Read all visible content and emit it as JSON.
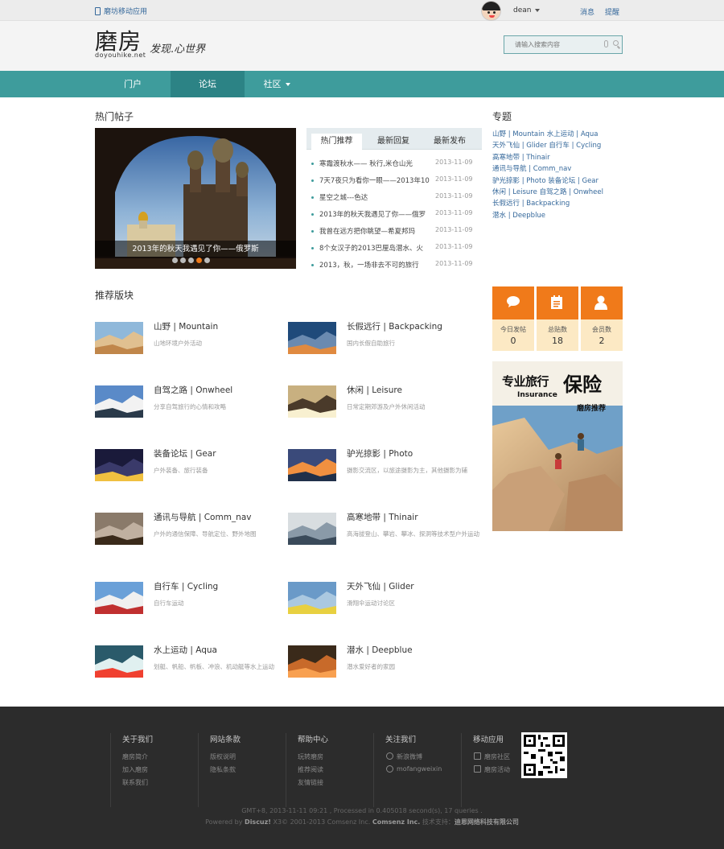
{
  "topbar": {
    "mobile_app": "磨坊移动应用",
    "username": "dean",
    "messages": "消息",
    "reminders": "提醒"
  },
  "header": {
    "logo": "磨房",
    "logo_sub": "doyouhike.net",
    "slogan": "发现.心世界",
    "search_placeholder": "请输入搜索内容"
  },
  "nav": {
    "items": [
      "门户",
      "论坛",
      "社区"
    ],
    "active": "论坛"
  },
  "hot": {
    "title": "热门帖子",
    "slide_caption": "2013年的秋天我遇见了你——俄罗斯",
    "slide_count": 5,
    "slide_active": 4,
    "tabs": [
      "热门推荐",
      "最新回复",
      "最新发布"
    ],
    "items": [
      {
        "title": "寒霜渡秋水—— 秋行,米仓山光",
        "date": "2013-11-09"
      },
      {
        "title": "7天7夜只为看你一眼——2013年10",
        "date": "2013-11-09"
      },
      {
        "title": "星空之城---色达",
        "date": "2013-11-09"
      },
      {
        "title": "2013年的秋天我遇见了你——俄罗",
        "date": "2013-11-09"
      },
      {
        "title": "我曾在远方把你眺望—希夏邦玛",
        "date": "2013-11-09"
      },
      {
        "title": "8个女汉子的2013巴厘岛潜水、火",
        "date": "2013-11-09"
      },
      {
        "title": "2013，秋，一场非去不可的旅行",
        "date": "2013-11-09"
      }
    ]
  },
  "topics": {
    "title": "专题",
    "lines": [
      "山野 | Mountain  水上运动 | Aqua",
      "天外飞仙 | Glider  自行车 | Cycling",
      "高寒地带 | Thinair",
      "通讯与导航 | Comm_nav",
      "驴光掠影 | Photo  装备论坛 | Gear",
      "休闲 | Leisure  自驾之路 | Onwheel",
      "长假远行 | Backpacking",
      "潜水 | Deepblue"
    ]
  },
  "forums": {
    "title": "推荐版块",
    "items": [
      {
        "name": "山野 | Mountain",
        "desc": "山地环境户外活动"
      },
      {
        "name": "长假远行 | Backpacking",
        "desc": "国内长假自助旅行"
      },
      {
        "name": "自驾之路 | Onwheel",
        "desc": "分享自驾旅行的心情和攻略"
      },
      {
        "name": "休闲 | Leisure",
        "desc": "日常定期郊游及户外休闲活动"
      },
      {
        "name": "装备论坛 | Gear",
        "desc": "户外装备、旅行装备"
      },
      {
        "name": "驴光掠影 | Photo",
        "desc": "摄影交流区，以旅途摄影为主，其他摄影为辅"
      },
      {
        "name": "通讯与导航 | Comm_nav",
        "desc": "户外的通信保障、导航定位、野外地图"
      },
      {
        "name": "高寒地带 | Thinair",
        "desc": "高海拔登山、攀岩、攀冰、探洞等技术型户外运动"
      },
      {
        "name": "自行车 | Cycling",
        "desc": "自行车运动"
      },
      {
        "name": "天外飞仙 | Glider",
        "desc": "滑翔伞运动讨论区"
      },
      {
        "name": "水上运动 | Aqua",
        "desc": "划艇、帆船、帆板、冲浪、机动艇等水上运动"
      },
      {
        "name": "潜水 | Deepblue",
        "desc": "潜水爱好者的家园"
      }
    ]
  },
  "stats": [
    {
      "label": "今日发帖",
      "value": "0",
      "icon": "chat-icon"
    },
    {
      "label": "总贴数",
      "value": "18",
      "icon": "document-icon"
    },
    {
      "label": "会员数",
      "value": "2",
      "icon": "user-icon"
    }
  ],
  "ad": {
    "title": "专业旅行",
    "title_big": "保险",
    "sub": "Insurance",
    "badge": "磨房推荐"
  },
  "footer": {
    "columns": [
      {
        "title": "关于我们",
        "links": [
          "磨房简介",
          "加入磨房",
          "联系我们"
        ]
      },
      {
        "title": "网站条款",
        "links": [
          "版权说明",
          "隐私条款"
        ]
      },
      {
        "title": "帮助中心",
        "links": [
          "玩转磨房",
          "推荐阅读",
          "友情链接"
        ]
      },
      {
        "title": "关注我们",
        "links": [
          "新浪微博",
          "mofangweixin"
        ]
      },
      {
        "title": "移动应用",
        "links": [
          "磨房社区",
          "磨房活动"
        ]
      }
    ],
    "copyright1": "GMT+8, 2013-11-11 09:21 , Processed in 0.405018 second(s), 17 queries .",
    "copyright2_pre": "Powered by ",
    "copyright2_discuz": "Discuz!",
    "copyright2_mid": " X3© 2001-2013 Comsenz Inc. ",
    "copyright2_comsenz": "Comsenz Inc.",
    "copyright2_support": " 技术支持：",
    "copyright2_company": "迪恩网络科技有限公司"
  },
  "colors": {
    "teal": "#3e9c9c",
    "teal_active": "#2c8385",
    "orange": "#f07a1a",
    "link": "#35689b",
    "footer_bg": "#2c2c2c"
  }
}
